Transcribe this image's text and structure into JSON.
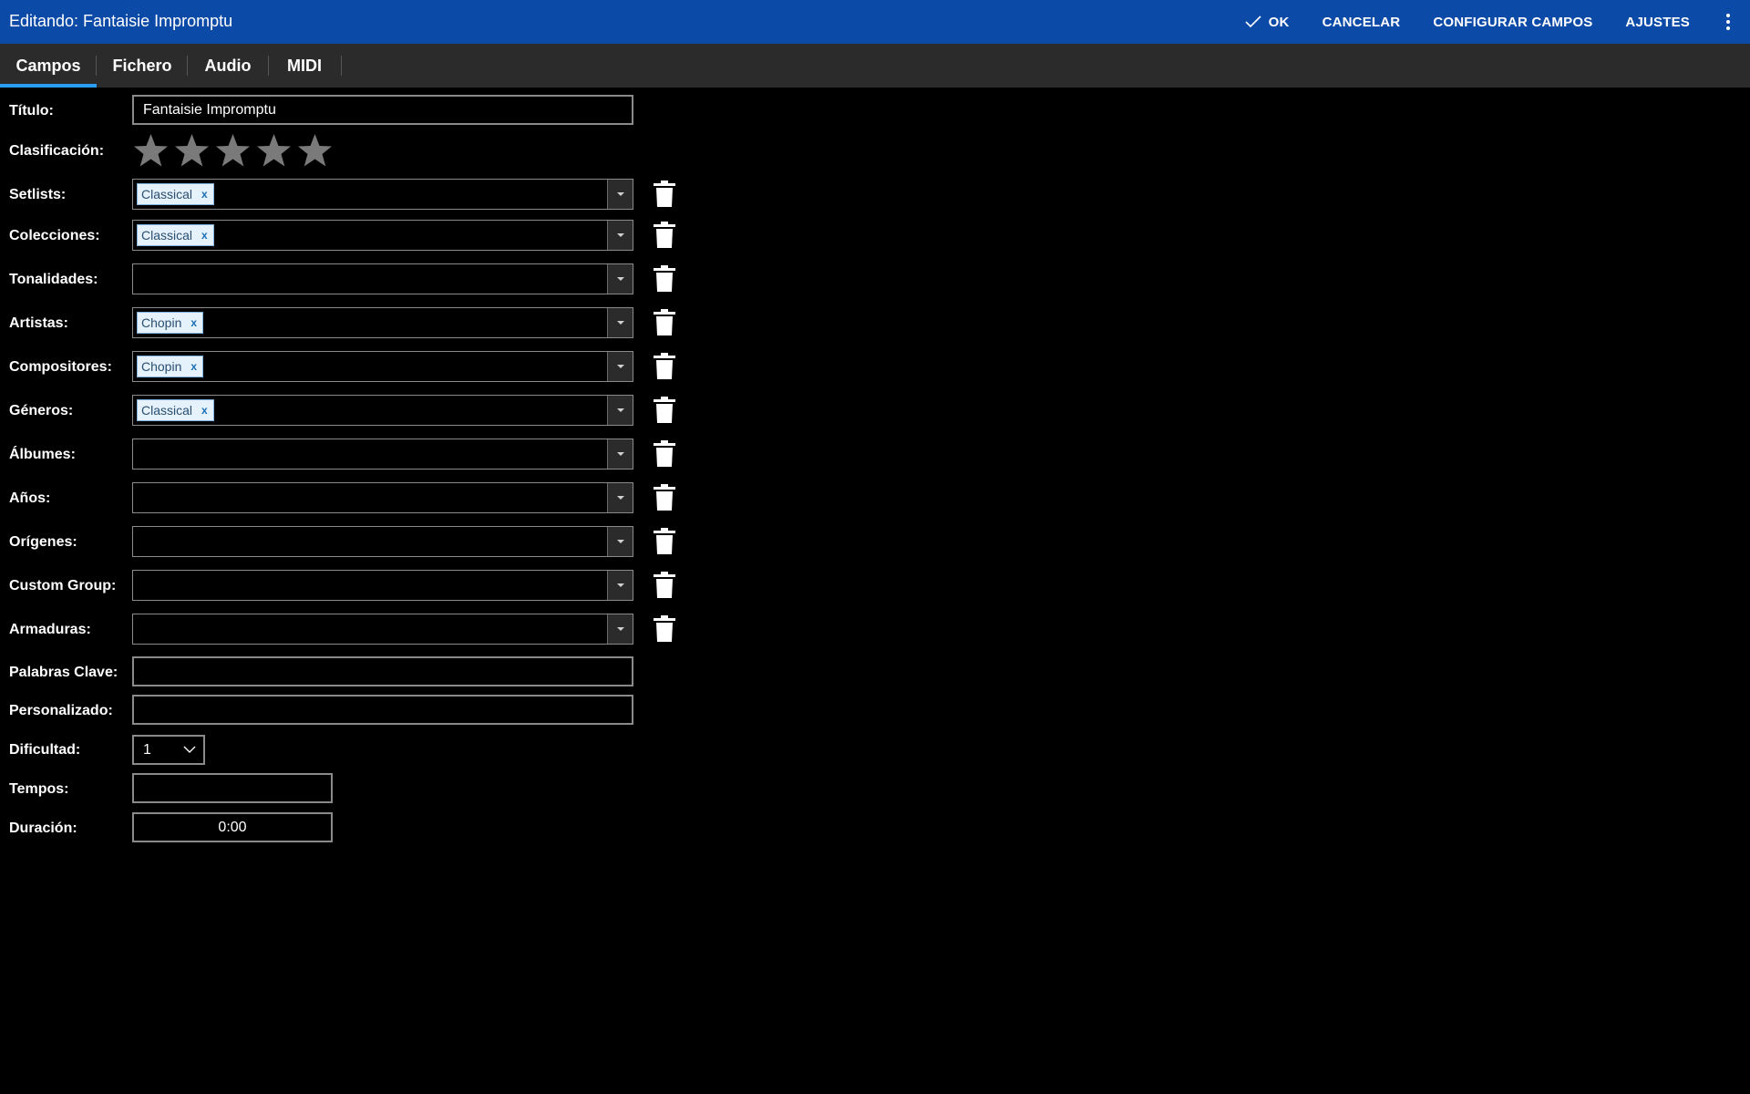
{
  "titlebar": {
    "title": "Editando: Fantaisie Impromptu",
    "ok_label": "OK",
    "cancel_label": "CANCELAR",
    "configure_label": "CONFIGURAR CAMPOS",
    "settings_label": "AJUSTES"
  },
  "tabs": [
    {
      "label": "Campos",
      "active": true
    },
    {
      "label": "Fichero",
      "active": false
    },
    {
      "label": "Audio",
      "active": false
    },
    {
      "label": "MIDI",
      "active": false
    }
  ],
  "form": {
    "title_label": "Título:",
    "title_value": "Fantaisie Impromptu",
    "rating_label": "Clasificación:",
    "rating": 0,
    "rating_max": 5,
    "setlists_label": "Setlists:",
    "setlists_chip": "Classical",
    "collections_label": "Colecciones:",
    "collections_chip": "Classical",
    "keys_label": "Tonalidades:",
    "artists_label": "Artistas:",
    "artists_chip": "Chopin",
    "composers_label": "Compositores:",
    "composers_chip": "Chopin",
    "genres_label": "Géneros:",
    "genres_chip": "Classical",
    "albums_label": "Álbumes:",
    "years_label": "Años:",
    "sources_label": "Orígenes:",
    "custom_group_label": "Custom Group:",
    "key_signatures_label": "Armaduras:",
    "keywords_label": "Palabras Clave:",
    "keywords_value": "",
    "custom_label": "Personalizado:",
    "custom_value": "",
    "difficulty_label": "Dificultad:",
    "difficulty_value": "1",
    "tempo_label": "Tempos:",
    "tempo_value": "",
    "duration_label": "Duración:",
    "duration_value": "0:00",
    "chip_remove": "x"
  },
  "colors": {
    "titlebar": "#0c4aa8",
    "tabbar": "#2b2b2b",
    "tab_indicator": "#2a9df4",
    "star": "#7a7a7a"
  }
}
